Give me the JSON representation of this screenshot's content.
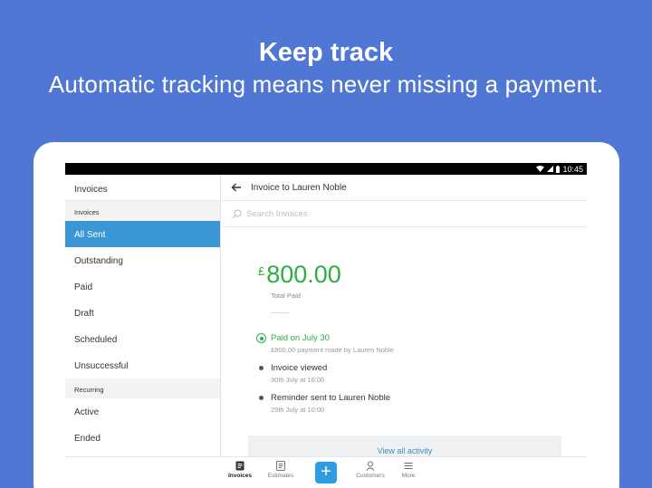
{
  "hero": {
    "title": "Keep track",
    "subtitle": "Automatic tracking means never missing a payment."
  },
  "statusbar": {
    "time": "10:45",
    "icons": [
      "wifi-icon",
      "signal-icon",
      "battery-icon"
    ]
  },
  "sidebar": {
    "header": "Invoices",
    "section_invoices": "Invoices",
    "items": [
      {
        "label": "All Sent",
        "active": true
      },
      {
        "label": "Outstanding"
      },
      {
        "label": "Paid"
      },
      {
        "label": "Draft"
      },
      {
        "label": "Scheduled"
      },
      {
        "label": "Unsuccessful"
      }
    ],
    "section_recurring": "Recurring",
    "recurring_items": [
      {
        "label": "Active"
      },
      {
        "label": "Ended"
      }
    ]
  },
  "main": {
    "title": "Invoice to Lauren Noble",
    "search_placeholder": "Search Invoices",
    "amount_currency": "£",
    "amount_value": "800.00",
    "amount_label": "Total Paid",
    "timeline": [
      {
        "title": "Paid on July 30",
        "sub": "£800.00 payment made by Lauren Noble"
      },
      {
        "title": "Invoice viewed",
        "sub": "30th July at 16:00"
      },
      {
        "title": "Reminder sent to Lauren Noble",
        "sub": "29th July at 10:00"
      }
    ],
    "view_all": "View all activity"
  },
  "bottom_nav": {
    "invoices": "Invoices",
    "estimates": "Estimates",
    "add": "+",
    "customers": "Customers",
    "more": "More"
  },
  "colors": {
    "background": "#4f77d3",
    "accent": "#3a96d4",
    "success": "#2fad44"
  }
}
